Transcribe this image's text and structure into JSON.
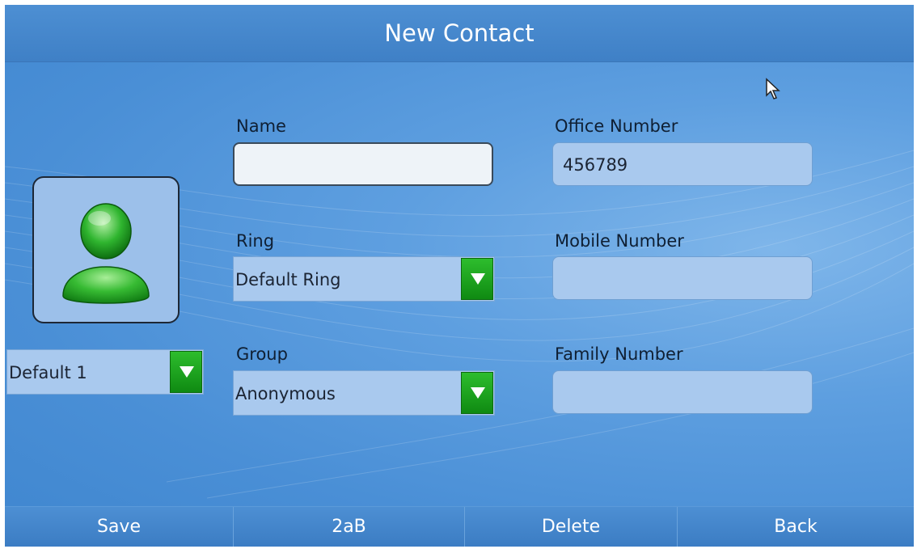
{
  "header": {
    "title": "New Contact"
  },
  "form": {
    "name": {
      "label": "Name",
      "value": ""
    },
    "ring": {
      "label": "Ring",
      "value": "Default Ring"
    },
    "group": {
      "label": "Group",
      "value": "Anonymous"
    },
    "office": {
      "label": "Office Number",
      "value": "456789"
    },
    "mobile": {
      "label": "Mobile Number",
      "value": ""
    },
    "family": {
      "label": "Family Number",
      "value": ""
    }
  },
  "photo": {
    "value": "Default 1",
    "icon": "person-icon"
  },
  "softkeys": {
    "save": "Save",
    "input_mode": "2aB",
    "delete": "Delete",
    "back": "Back"
  },
  "colors": {
    "accent": "#0f8a12",
    "background": "#4a8fd6"
  }
}
